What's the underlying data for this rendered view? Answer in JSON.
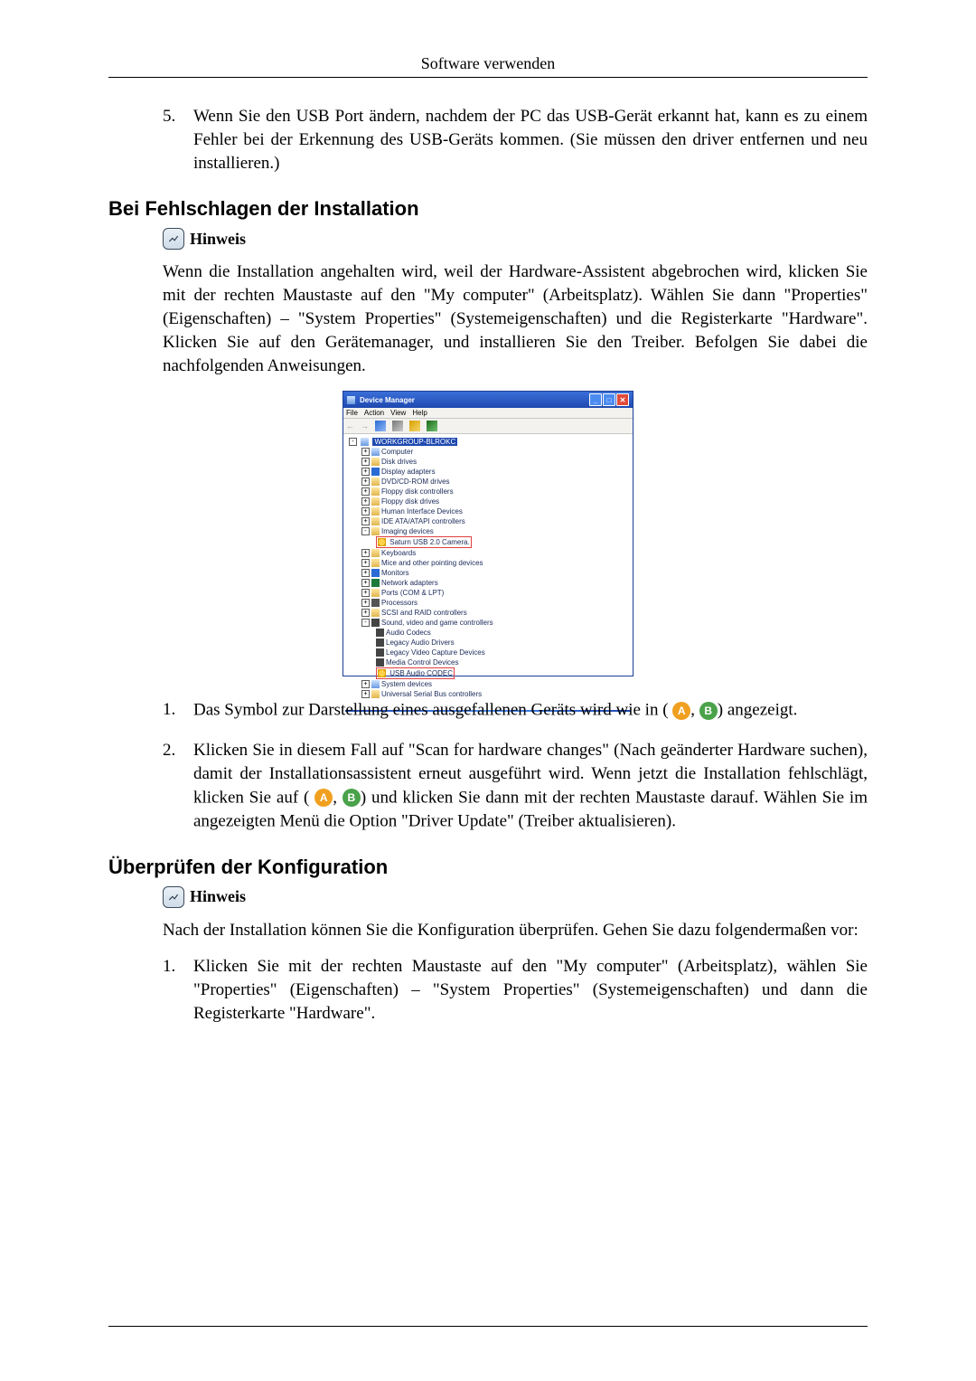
{
  "header": {
    "title": "Software verwenden"
  },
  "item5": {
    "num": "5.",
    "text": "Wenn Sie den USB Port ändern, nachdem der PC das USB-Gerät erkannt hat, kann es zu einem Fehler bei der Erkennung des USB-Geräts kommen. (Sie müssen den driver entfernen und neu installieren.)"
  },
  "sectionA": {
    "title": "Bei Fehlschlagen der Installation",
    "hinweis": "Hinweis",
    "para": "Wenn die Installation angehalten wird, weil der Hardware-Assistent abgebrochen wird, klicken Sie mit der rechten Maustaste auf den \"My computer\" (Arbeitsplatz). Wählen Sie dann \"Properties\" (Eigenschaften) – \"System Properties\" (Systemeigenschaften) und die Registerkarte \"Hardware\". Klicken Sie auf den Gerätemanager, und installieren Sie den Treiber. Befolgen Sie dabei die nachfolgenden Anweisungen."
  },
  "dm": {
    "title": "Device Manager",
    "menu": {
      "file": "File",
      "action": "Action",
      "view": "View",
      "help": "Help"
    },
    "root": "WORKGROUP-BLROKC",
    "nodes": {
      "computer": "Computer",
      "disk": "Disk drives",
      "display": "Display adapters",
      "dvd": "DVD/CD-ROM drives",
      "floppyctl": "Floppy disk controllers",
      "floppydrv": "Floppy disk drives",
      "hid": "Human Interface Devices",
      "ide": "IDE ATA/ATAPI controllers",
      "imaging": "Imaging devices",
      "saturn": "Saturn USB 2.0 Camera.",
      "keyboards": "Keyboards",
      "mice": "Mice and other pointing devices",
      "monitors": "Monitors",
      "network": "Network adapters",
      "ports": "Ports (COM & LPT)",
      "processors": "Processors",
      "scsi": "SCSI and RAID controllers",
      "sound": "Sound, video and game controllers",
      "audiocodecs": "Audio Codecs",
      "legacyaudio": "Legacy Audio Drivers",
      "legacyvideo": "Legacy Video Capture Devices",
      "mediactl": "Media Control Devices",
      "usbaudio": "USB Audio CODEC",
      "system": "System devices",
      "usb": "Universal Serial Bus controllers"
    }
  },
  "listB": {
    "i1_num": "1.",
    "i1_pre": "Das Symbol zur Darstellung eines ausgefallenen Geräts wird wie in (",
    "i1_sep": ",",
    "i1_post": ") angezeigt.",
    "i2_num": "2.",
    "i2_line1": "Klicken Sie in diesem Fall auf \"Scan for hardware changes\" (Nach geänderter Hardware suchen), damit der Installationsassistent erneut ausgeführt wird. Wenn jetzt die Installation fehlschlägt,",
    "i2_pre": "klicken Sie auf (",
    "i2_sep": ",",
    "i2_post": ") und klicken Sie dann mit der rechten Maustaste darauf. Wählen Sie im angezeigten Menü die Option \"Driver Update\" (Treiber aktualisieren)."
  },
  "sectionB": {
    "title": "Überprüfen der Konfiguration",
    "hinweis": "Hinweis",
    "para": "Nach der Installation können Sie die Konfiguration überprüfen. Gehen Sie dazu folgendermaßen vor:",
    "i1_num": "1.",
    "i1_text": "Klicken Sie mit der rechten Maustaste auf den \"My computer\" (Arbeitsplatz), wählen Sie \"Properties\" (Eigenschaften) – \"System Properties\" (Systemeigenschaften) und dann die Registerkarte \"Hardware\"."
  },
  "badges": {
    "A": "A",
    "B": "B"
  }
}
